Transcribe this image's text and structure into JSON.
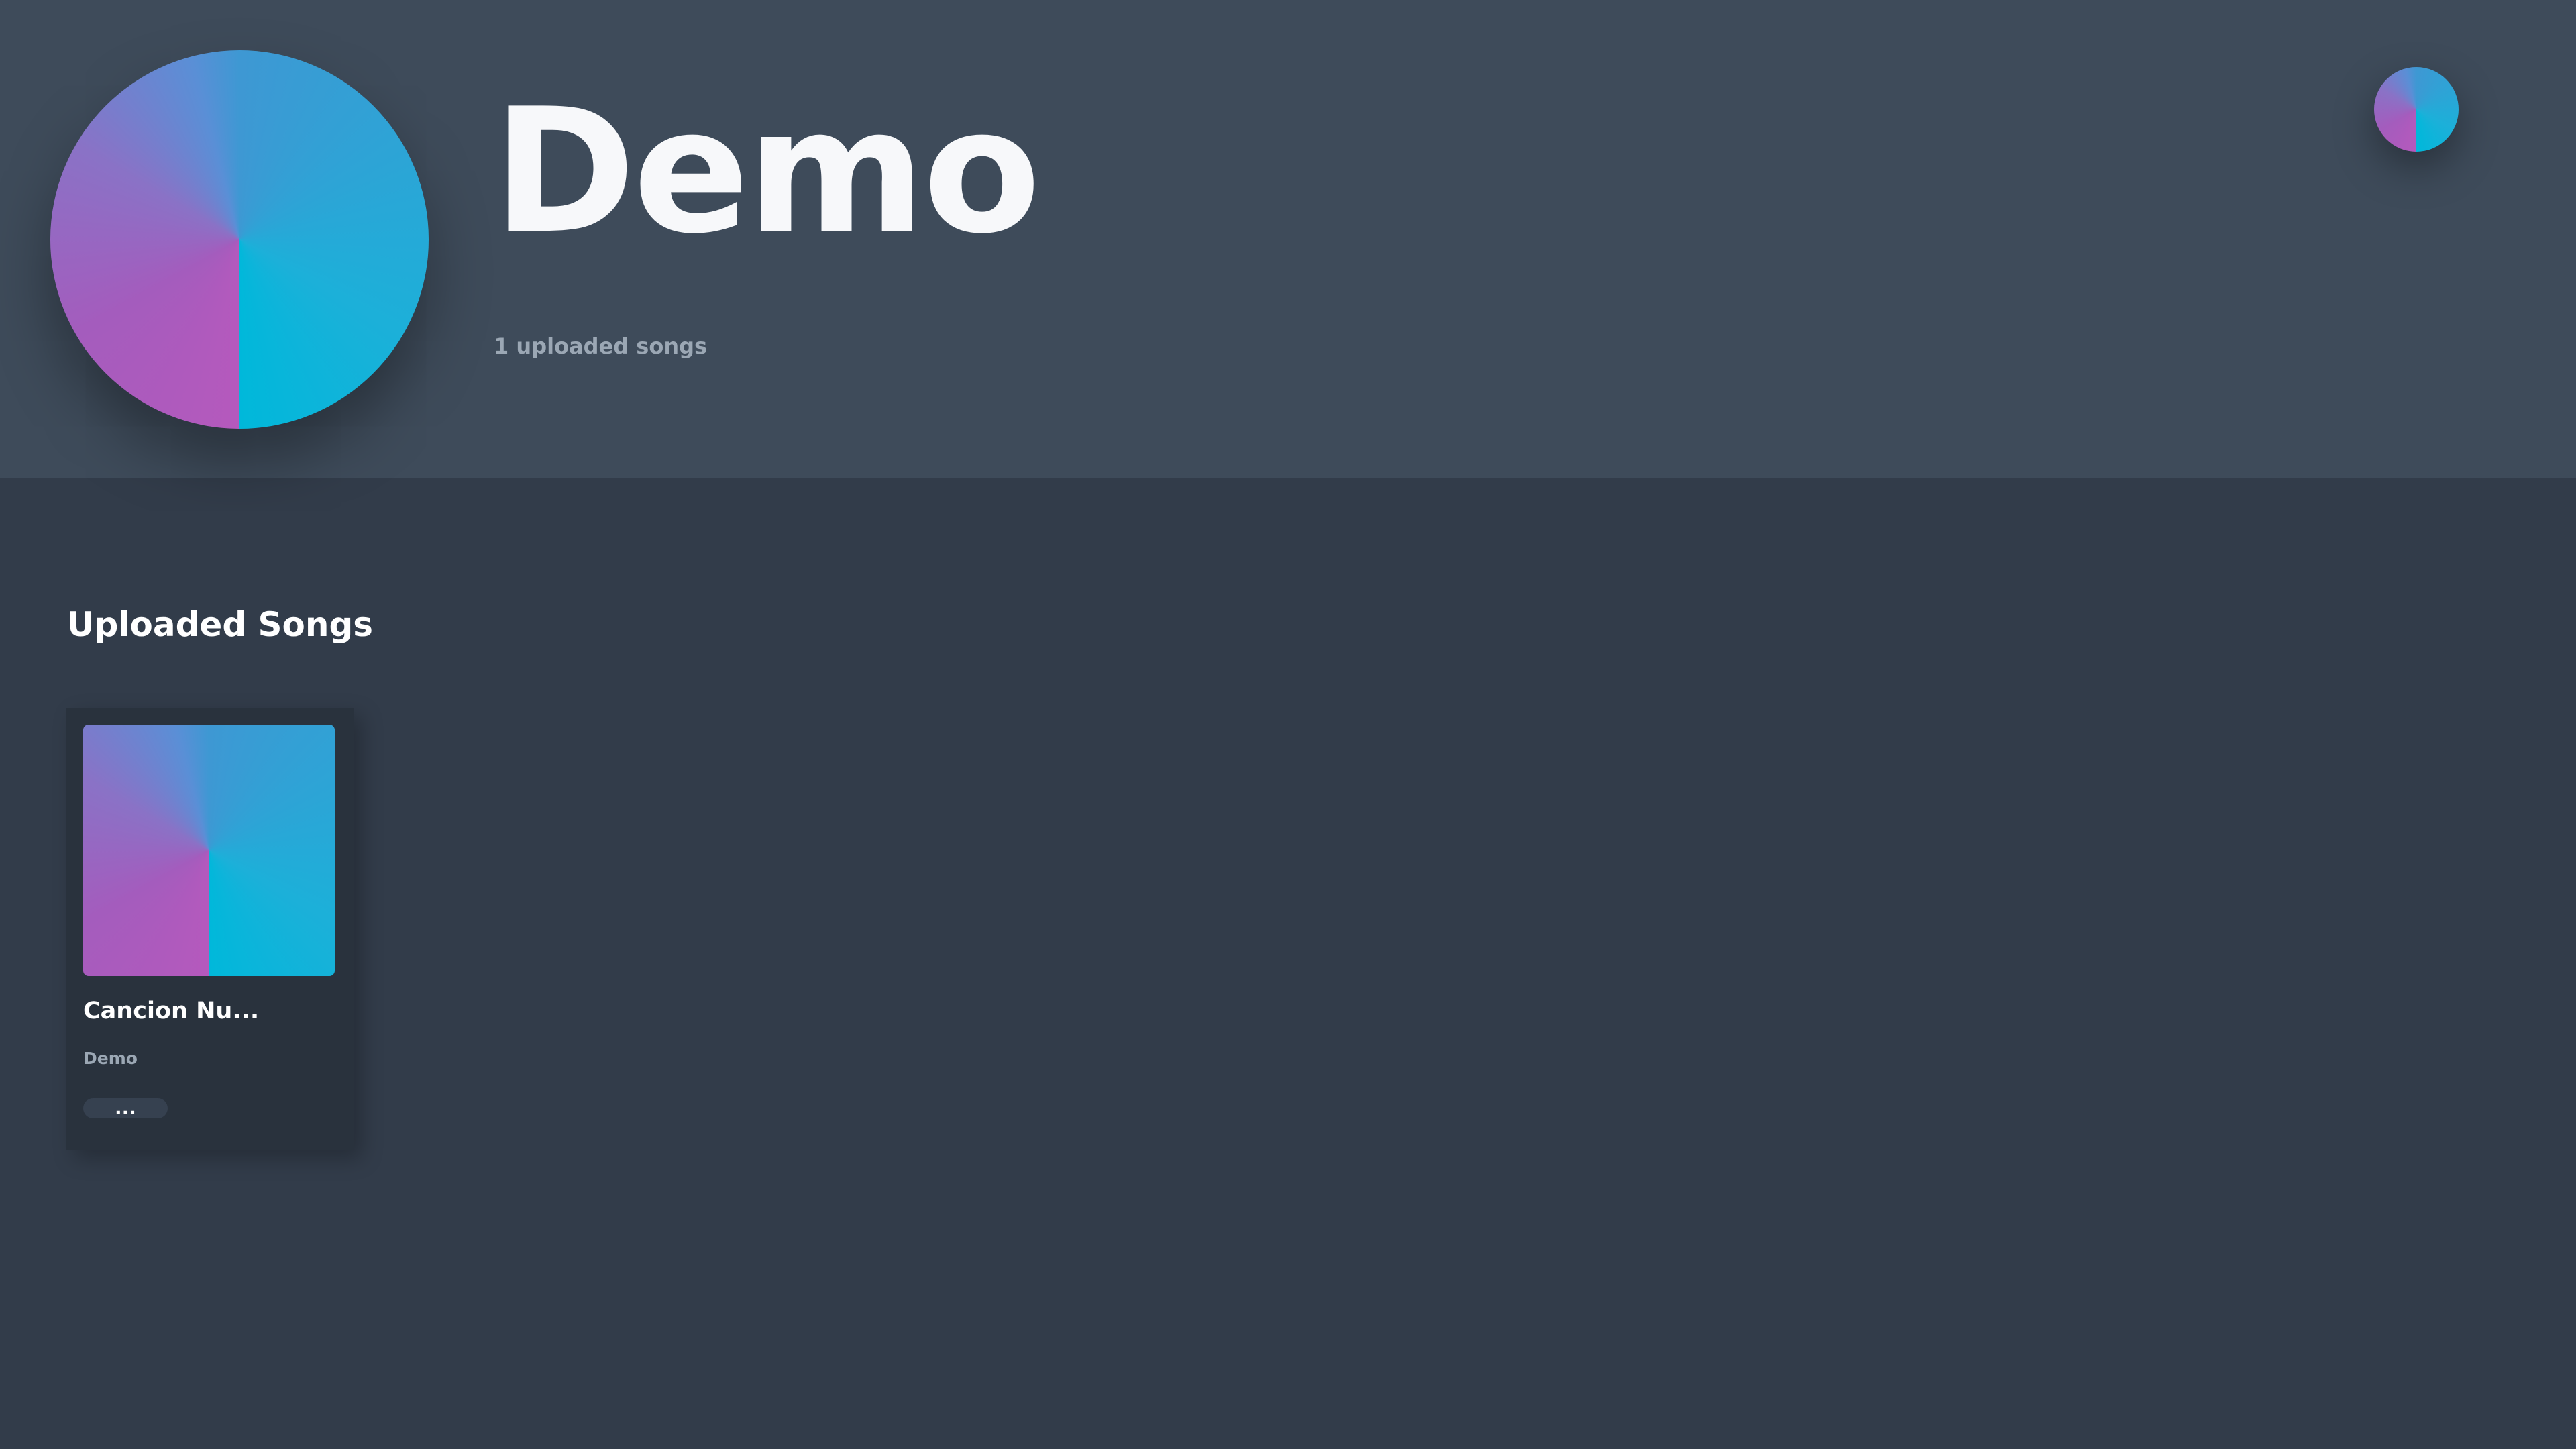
{
  "profile": {
    "name": "Demo",
    "stats": "1 uploaded songs"
  },
  "section": {
    "title": "Uploaded Songs"
  },
  "songs": [
    {
      "title": "Cancion Nu...",
      "artist": "Demo",
      "more_label": "..."
    }
  ],
  "colors": {
    "header_bg": "#3e4b5a",
    "page_bg": "#323c4a",
    "card_bg": "#29323d",
    "gradient_cyan": "#00b8da",
    "gradient_magenta": "#b559bd",
    "gradient_blue": "#3e98d3",
    "muted_text": "#9ba7b4"
  }
}
